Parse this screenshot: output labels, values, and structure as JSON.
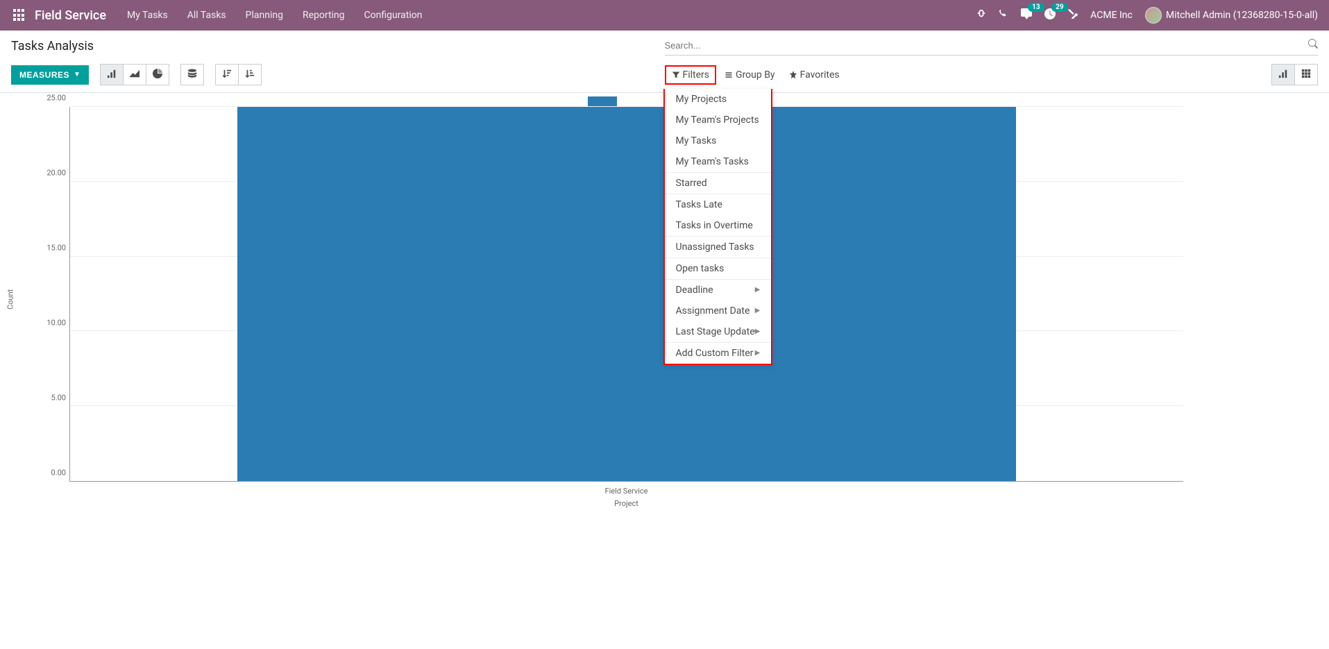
{
  "navbar": {
    "brand": "Field Service",
    "menu": [
      "My Tasks",
      "All Tasks",
      "Planning",
      "Reporting",
      "Configuration"
    ],
    "messages_badge": "13",
    "activities_badge": "29",
    "company": "ACME Inc",
    "user": "Mitchell Admin (12368280-15-0-all)"
  },
  "cp": {
    "title": "Tasks Analysis",
    "search_placeholder": "Search...",
    "measures_label": "MEASURES"
  },
  "search_options": {
    "filters": "Filters",
    "group_by": "Group By",
    "favorites": "Favorites"
  },
  "filters_dropdown": {
    "group1": [
      "My Projects",
      "My Team's Projects",
      "My Tasks",
      "My Team's Tasks"
    ],
    "group2": [
      "Starred"
    ],
    "group3": [
      "Tasks Late",
      "Tasks in Overtime"
    ],
    "group4": [
      "Unassigned Tasks"
    ],
    "group5": [
      "Open tasks"
    ],
    "group6_submenu": [
      "Deadline",
      "Assignment Date",
      "Last Stage Update"
    ],
    "group7_submenu": [
      "Add Custom Filter"
    ]
  },
  "chart_data": {
    "type": "bar",
    "categories": [
      "Field Service"
    ],
    "values": [
      25
    ],
    "xlabel_top": "Field Service",
    "xlabel_bottom": "Project",
    "ylabel": "Count",
    "ylim": [
      0,
      25
    ],
    "y_ticks": [
      "0.00",
      "5.00",
      "10.00",
      "15.00",
      "20.00",
      "25.00"
    ]
  }
}
